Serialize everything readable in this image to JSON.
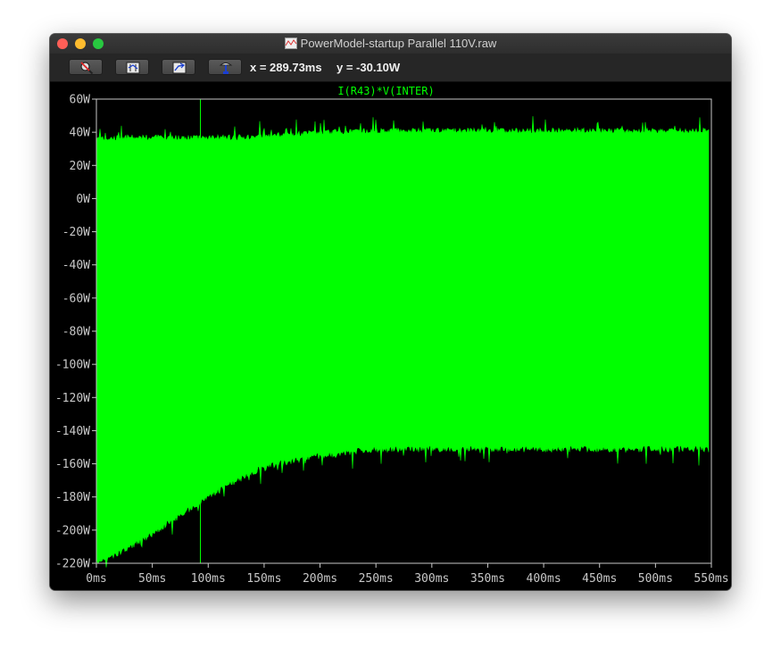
{
  "window": {
    "title": "PowerModel-startup Parallel 110V.raw"
  },
  "toolbar": {
    "buttons": [
      {
        "name": "zoom-cancel-button",
        "icon": "magnifier-cross-icon"
      },
      {
        "name": "autorange-button",
        "icon": "autorange-icon"
      },
      {
        "name": "zoom-back-button",
        "icon": "zoom-back-icon"
      },
      {
        "name": "probe-button",
        "icon": "probe-icon"
      }
    ],
    "cursor_x": "x = 289.73ms",
    "cursor_y": "y = -30.10W"
  },
  "colors": {
    "trace": "#00ff00",
    "background": "#000000",
    "axis": "#c8c8c8",
    "trace_label": "#00ff00"
  },
  "chart_data": {
    "type": "area",
    "title": "I(R43)*V(INTER)",
    "xlabel": "",
    "ylabel": "",
    "xlim": [
      0,
      550
    ],
    "ylim": [
      -220,
      60
    ],
    "x_ticks": [
      "0ms",
      "50ms",
      "100ms",
      "150ms",
      "200ms",
      "250ms",
      "300ms",
      "350ms",
      "400ms",
      "450ms",
      "500ms",
      "550ms"
    ],
    "y_ticks": [
      "60W",
      "40W",
      "20W",
      "0W",
      "-20W",
      "-40W",
      "-60W",
      "-80W",
      "-100W",
      "-120W",
      "-140W",
      "-160W",
      "-180W",
      "-200W",
      "-220W"
    ],
    "grid": false,
    "cursor": {
      "x": 93
    },
    "series": [
      {
        "name": "I(R43)*V(INTER)",
        "x": [
          0,
          25,
          50,
          75,
          100,
          125,
          150,
          175,
          200,
          250,
          300,
          350,
          400,
          450,
          500,
          548
        ],
        "upper": [
          34,
          35,
          35,
          35,
          35,
          35,
          36,
          37,
          38,
          39,
          39,
          39,
          39,
          39,
          39,
          39
        ],
        "lower": [
          -218,
          -210,
          -200,
          -189,
          -178,
          -168,
          -160,
          -156,
          -153,
          -149,
          -149,
          -149,
          -149,
          -149,
          -149,
          -149
        ]
      }
    ]
  }
}
